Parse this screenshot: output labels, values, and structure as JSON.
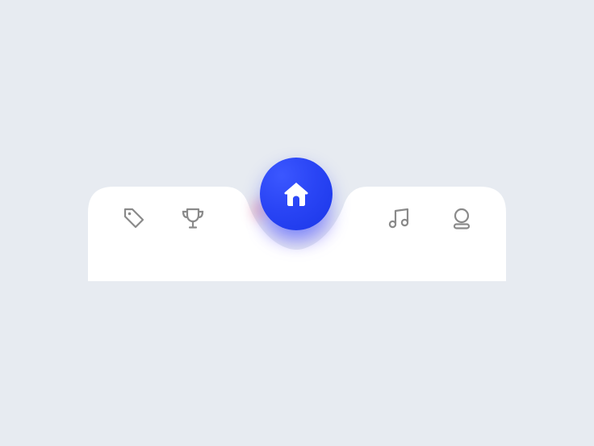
{
  "colors": {
    "background": "#e7ebf1",
    "bar": "#ffffff",
    "accent": "#2a45f5",
    "icon": "#8a8a8a",
    "home_icon": "#ffffff"
  },
  "nav": {
    "active": "home",
    "items": [
      {
        "id": "tag",
        "icon": "tag-icon"
      },
      {
        "id": "trophy",
        "icon": "trophy-icon"
      },
      {
        "id": "home",
        "icon": "home-icon"
      },
      {
        "id": "music",
        "icon": "music-note-icon"
      },
      {
        "id": "profile",
        "icon": "user-icon"
      }
    ]
  }
}
